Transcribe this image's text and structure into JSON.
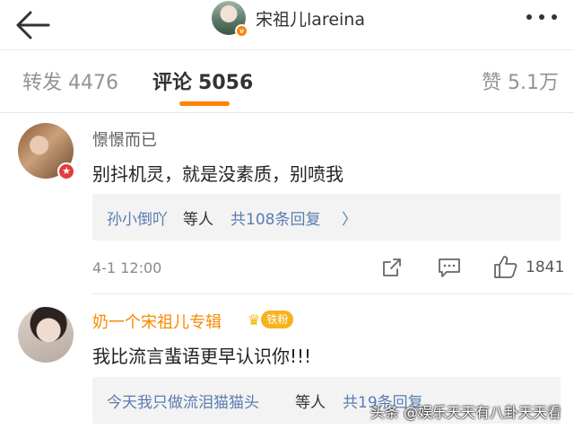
{
  "header": {
    "title": "宋祖儿lareina",
    "verified_badge": "v",
    "back_icon": "back-arrow-icon",
    "more_icon": "more-dots-icon"
  },
  "tabs": [
    {
      "label": "转发",
      "count": "4476",
      "active": false
    },
    {
      "label": "评论",
      "count": "5056",
      "active": true
    },
    {
      "label": "赞",
      "count": "5.1万",
      "active": false
    }
  ],
  "comments": [
    {
      "username": "憬憬而已",
      "text": "别抖机灵，就是没素质，别喷我",
      "reply_from": "孙小倒吖",
      "reply_mid": "等人",
      "reply_count": "共108条回复",
      "reply_arrow": "〉",
      "time": "4-1 12:00",
      "likes": "1841"
    },
    {
      "username": "奶一个宋祖儿专辑",
      "fan_badge": "铁粉",
      "text": "我比流言蜚语更早认识你!!!",
      "reply_from": "今天我只做流泪猫猫头",
      "reply_mid": "等人",
      "reply_count": "共19条回复"
    }
  ],
  "watermark": "头条 @娱乐天天有八卦天天看",
  "colors": {
    "accent": "#ff8200",
    "link": "#5b7cb1",
    "fan_badge": "#f7b21c"
  }
}
